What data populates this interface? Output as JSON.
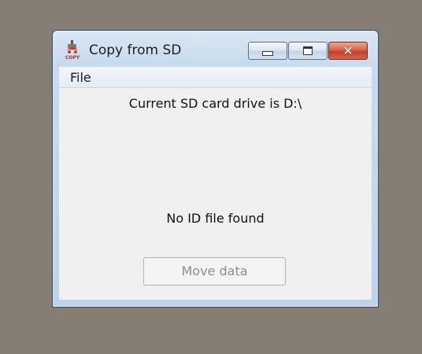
{
  "window": {
    "title": "Copy from SD",
    "icon": "sd-copy-app-icon",
    "icon_text": "COPY"
  },
  "titlebar": {
    "buttons": [
      {
        "name": "minimize",
        "icon": "minimize-icon"
      },
      {
        "name": "maximize",
        "icon": "maximize-icon"
      },
      {
        "name": "close",
        "icon": "close-icon",
        "glyph": "✕"
      }
    ]
  },
  "menubar": {
    "items": [
      {
        "label": "File"
      }
    ]
  },
  "content": {
    "drive_text": "Current SD card drive is D:\\",
    "status_text": "No ID file found",
    "move_button_label": "Move data",
    "move_button_enabled": false
  },
  "colors": {
    "desktop": "#857e74",
    "close_button": "#c2412a",
    "client_background": "#f0f0f0"
  }
}
